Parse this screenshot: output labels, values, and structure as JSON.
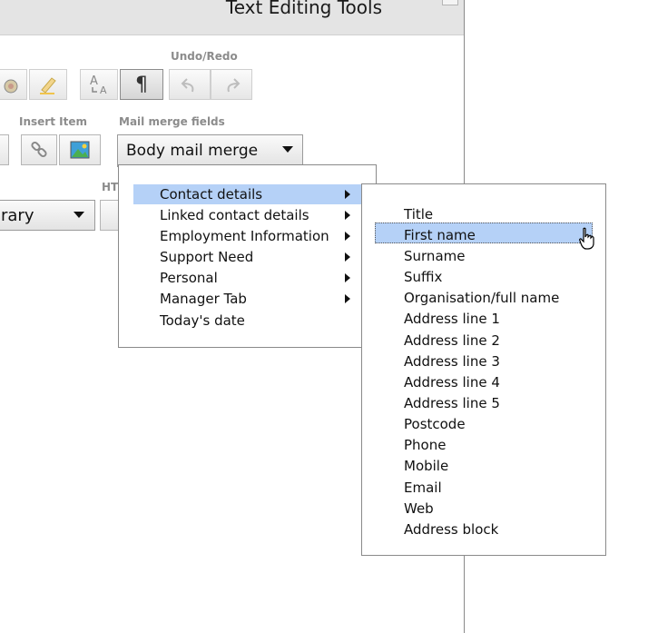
{
  "window": {
    "title": "Text Editing Tools"
  },
  "toolbar": {
    "undo_redo_label": "Undo/Redo",
    "insert_item_label": "Insert Item",
    "mail_merge_label": "Mail merge fields",
    "html_label_partial": "HT",
    "library_dropdown_value": "rary",
    "mail_merge_dropdown_value": "Body mail merge"
  },
  "mail_merge_menu": {
    "items": [
      {
        "label": "Contact details",
        "has_submenu": true,
        "highlighted": true
      },
      {
        "label": "Linked contact details",
        "has_submenu": true
      },
      {
        "label": "Employment Information",
        "has_submenu": true
      },
      {
        "label": "Support Need",
        "has_submenu": true
      },
      {
        "label": "Personal",
        "has_submenu": true
      },
      {
        "label": "Manager Tab",
        "has_submenu": true
      },
      {
        "label": "Today's date",
        "has_submenu": false
      }
    ]
  },
  "contact_submenu": {
    "items": [
      "Title",
      "First name",
      "Surname",
      "Suffix",
      "Organisation/full name",
      "Address line 1",
      "Address line 2",
      "Address line 3",
      "Address line 4",
      "Address line 5",
      "Postcode",
      "Phone",
      "Mobile",
      "Email",
      "Web",
      "Address block"
    ],
    "highlighted_index": 1
  },
  "colors": {
    "highlight": "#b5d1f7",
    "titlebar": "#e4e4e4"
  }
}
